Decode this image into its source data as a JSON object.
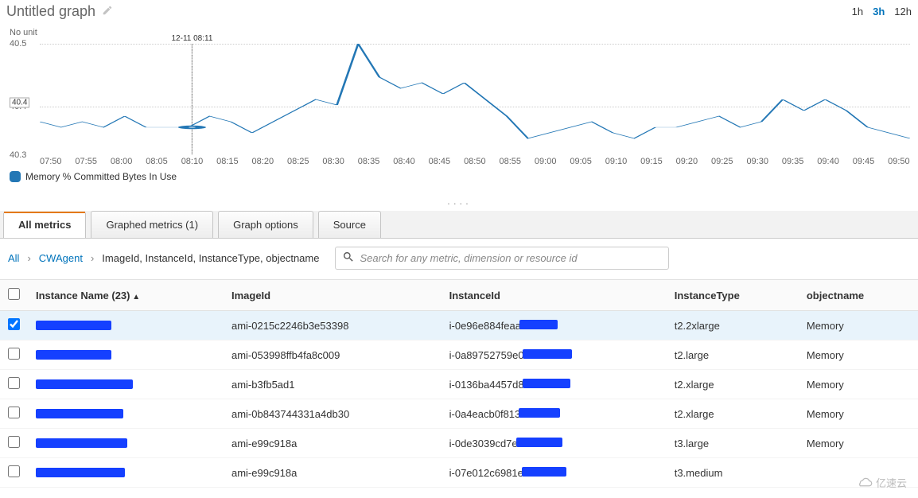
{
  "header": {
    "title": "Untitled graph",
    "time_ranges": [
      "1h",
      "3h",
      "12h"
    ],
    "selected_time_range": "3h"
  },
  "chart_data": {
    "type": "line",
    "unit_label": "No unit",
    "ylim": [
      40.3,
      40.5
    ],
    "yticks": [
      "40.5",
      "40.4",
      "40.3"
    ],
    "x_categories": [
      "07:50",
      "07:55",
      "08:00",
      "08:05",
      "08:10",
      "08:15",
      "08:20",
      "08:25",
      "08:30",
      "08:35",
      "08:40",
      "08:45",
      "08:50",
      "08:55",
      "09:00",
      "09:05",
      "09:10",
      "09:15",
      "09:20",
      "09:25",
      "09:30",
      "09:35",
      "09:40",
      "09:45",
      "09:50"
    ],
    "series": [
      {
        "name": "Memory % Committed Bytes In Use",
        "color": "#2377b5",
        "values": [
          40.36,
          40.35,
          40.36,
          40.35,
          40.37,
          40.35,
          40.35,
          40.35,
          40.37,
          40.36,
          40.34,
          40.36,
          40.38,
          40.4,
          40.39,
          40.5,
          40.44,
          40.42,
          40.43,
          40.41,
          40.43,
          40.4,
          40.37,
          40.33,
          40.34,
          40.35,
          40.36,
          40.34,
          40.33,
          40.35,
          40.35,
          40.36,
          40.37,
          40.35,
          40.36,
          40.4,
          40.38,
          40.4,
          40.38,
          40.35,
          40.34,
          40.33
        ]
      }
    ],
    "crosshair": {
      "index_frac": 0.175,
      "x_label": "12-11 08:11",
      "y_value": 40.35,
      "y_axis_label": "40.4"
    },
    "legend": [
      "Memory % Committed Bytes In Use"
    ]
  },
  "tabs": [
    {
      "id": "all-metrics",
      "label": "All metrics",
      "active": true
    },
    {
      "id": "graphed-metrics",
      "label": "Graphed metrics (1)",
      "active": false
    },
    {
      "id": "graph-options",
      "label": "Graph options",
      "active": false
    },
    {
      "id": "source",
      "label": "Source",
      "active": false
    }
  ],
  "breadcrumb": {
    "root": "All",
    "namespace": "CWAgent",
    "dimensions": "ImageId, InstanceId, InstanceType, objectname"
  },
  "search": {
    "placeholder": "Search for any metric, dimension or resource id"
  },
  "table": {
    "columns": [
      "Instance Name (23)",
      "ImageId",
      "InstanceId",
      "InstanceType",
      "objectname"
    ],
    "sorted_col": 0,
    "rows": [
      {
        "checked": true,
        "name_redact_w": 95,
        "image_id": "ami-0215c2246b3e53398",
        "inst_prefix": "i-0e96e884feaa",
        "inst_redact_w": 48,
        "itype": "t2.2xlarge",
        "obj": "Memory"
      },
      {
        "checked": false,
        "name_redact_w": 95,
        "image_id": "ami-053998ffb4fa8c009",
        "inst_prefix": "i-0a89752759e0",
        "inst_redact_w": 62,
        "itype": "t2.large",
        "obj": "Memory"
      },
      {
        "checked": false,
        "name_redact_w": 122,
        "image_id": "ami-b3fb5ad1",
        "inst_prefix": "i-0136ba4457d8",
        "inst_redact_w": 60,
        "itype": "t2.xlarge",
        "obj": "Memory"
      },
      {
        "checked": false,
        "name_redact_w": 110,
        "image_id": "ami-0b843744331a4db30",
        "inst_prefix": "i-0a4eacb0f813",
        "inst_redact_w": 52,
        "itype": "t2.xlarge",
        "obj": "Memory"
      },
      {
        "checked": false,
        "name_redact_w": 115,
        "image_id": "ami-e99c918a",
        "inst_prefix": "i-0de3039cd7e",
        "inst_redact_w": 58,
        "itype": "t3.large",
        "obj": "Memory"
      },
      {
        "checked": false,
        "name_redact_w": 112,
        "image_id": "ami-e99c918a",
        "inst_prefix": "i-07e012c6981e",
        "inst_redact_w": 56,
        "itype": "t3.medium",
        "obj": ""
      }
    ]
  },
  "watermark": "亿速云"
}
